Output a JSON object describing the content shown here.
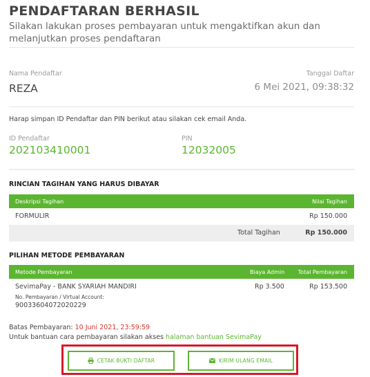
{
  "header": {
    "title": "PENDAFTARAN BERHASIL",
    "subtitle": "Silakan lakukan proses pembayaran untuk mengaktifkan akun dan melanjutkan proses pendaftaran"
  },
  "registrant": {
    "name_label": "Nama Pendaftar",
    "name": "REZA",
    "date_label": "Tanggal Daftar",
    "date": "6 Mei 2021, 09:38:32"
  },
  "credentials": {
    "notice": "Harap simpan ID Pendaftar dan PIN berikut atau silakan cek email Anda.",
    "id_label": "ID Pendaftar",
    "id": "202103410001",
    "pin_label": "PIN",
    "pin": "12032005"
  },
  "bill": {
    "section_title": "RINCIAN TAGIHAN YANG HARUS DIBAYAR",
    "col_desc": "Deskripsi Tagihan",
    "col_amount": "Nilai Tagihan",
    "item_desc": "FORMULIR",
    "item_amount": "Rp 150.000",
    "total_label": "Total Tagihan",
    "total_amount": "Rp 150.000"
  },
  "payment": {
    "section_title": "PILIHAN METODE PEMBAYARAN",
    "col_method": "Metode Pembayaran",
    "col_fee": "Biaya Admin",
    "col_total": "Total Pembayaran",
    "method": "SevimaPay - BANK SYARIAH MANDIRI",
    "account_label": "No. Pembayaran / Virtual Account:",
    "account_number": "90033604072020229",
    "fee": "Rp 3.500",
    "total": "Rp 153.500"
  },
  "deadline": {
    "label": "Batas Pembayaran: ",
    "value": "10 Juni 2021, 23:59:59",
    "help_text": "Untuk bantuan cara pembayaran silakan akses ",
    "help_link": "halaman bantuan SevimaPay"
  },
  "actions": {
    "print_label": "CETAK BUKTI DAFTAR",
    "email_label": "KIRIM ULANG EMAIL"
  },
  "colors": {
    "accent": "#5cb531",
    "deadline": "#d9322b",
    "highlight_frame": "#d6182a"
  },
  "icons": {
    "print": "printer-icon",
    "email": "envelope-icon"
  }
}
